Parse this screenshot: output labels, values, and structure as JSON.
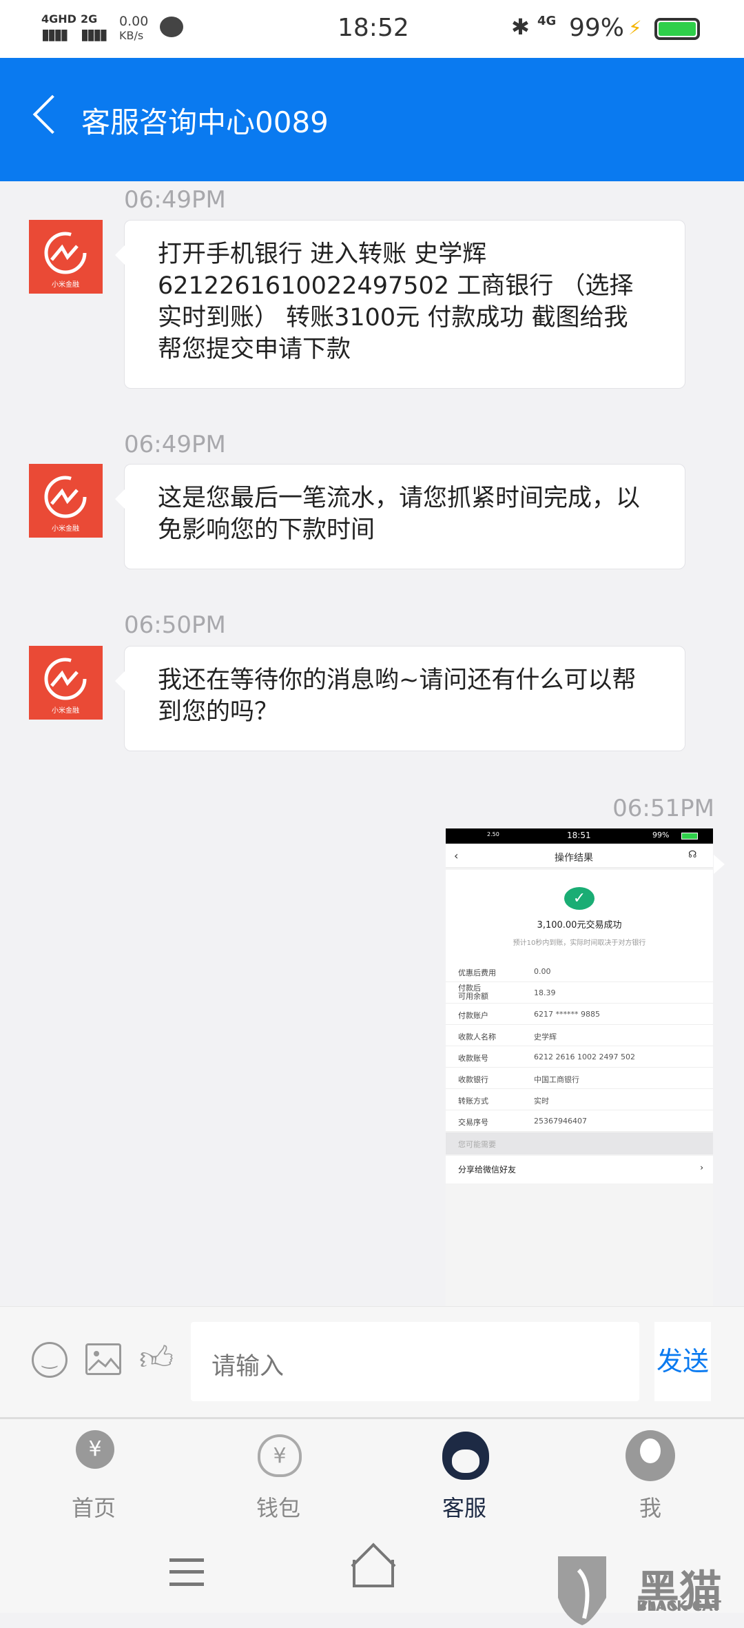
{
  "status_bar": {
    "network1": "4GHD",
    "network2": "2G",
    "speed": "0.00",
    "speed_unit": "KB/s",
    "time": "18:52",
    "net_right": "4G",
    "battery": "99%"
  },
  "header": {
    "title": "客服咨询中心0089"
  },
  "messages": [
    {
      "time": "06:49PM",
      "sender": "agent",
      "avatar_text": "小米金融",
      "text": "打开手机银行 进入转账 史学辉 6212261610022497502 工商银行 （选择实时到账） 转账3100元 付款成功 截图给我帮您提交申请下款"
    },
    {
      "time": "06:49PM",
      "sender": "agent",
      "avatar_text": "小米金融",
      "text": "这是您最后一笔流水，请您抓紧时间完成，以免影响您的下款时间"
    },
    {
      "time": "06:50PM",
      "sender": "agent",
      "avatar_text": "小米金融",
      "text": "我还在等待你的消息哟~请问还有什么可以帮到您的吗？"
    },
    {
      "time": "06:51PM",
      "sender": "user",
      "type": "image"
    }
  ],
  "receipt": {
    "status_time": "18:51",
    "status_speed": "2.50",
    "status_battery": "99%",
    "title": "操作结果",
    "amount_text": "3,100.00元交易成功",
    "note": "预计10秒内到账，实际时间取决于对方银行",
    "rows": [
      {
        "label": "优惠后费用",
        "value": "0.00"
      },
      {
        "label": "付款后\n可用余额",
        "value": "18.39"
      },
      {
        "label": "付款账户",
        "value": "6217 ****** 9885"
      },
      {
        "label": "收款人名称",
        "value": "史学辉"
      },
      {
        "label": "收款账号",
        "value": "6212 2616 1002 2497 502"
      },
      {
        "label": "收款银行",
        "value": "中国工商银行"
      },
      {
        "label": "转账方式",
        "value": "实时"
      },
      {
        "label": "交易序号",
        "value": "25367946407"
      }
    ],
    "section": "您可能需要",
    "share": "分享给微信好友",
    "success_color": "#1aad74"
  },
  "input": {
    "placeholder": "请输入",
    "send_label": "发送"
  },
  "tabs": [
    {
      "label": "首页",
      "icon": "home-yen-icon"
    },
    {
      "label": "钱包",
      "icon": "wallet-icon"
    },
    {
      "label": "客服",
      "icon": "customer-service-icon",
      "active": true
    },
    {
      "label": "我",
      "icon": "profile-icon"
    }
  ],
  "watermark": {
    "text": "黑猫",
    "sub": "BLACK CAT"
  },
  "colors": {
    "brand": "#0a7af0",
    "avatar": "#ea4a36",
    "active_tab": "#1d2a44"
  }
}
